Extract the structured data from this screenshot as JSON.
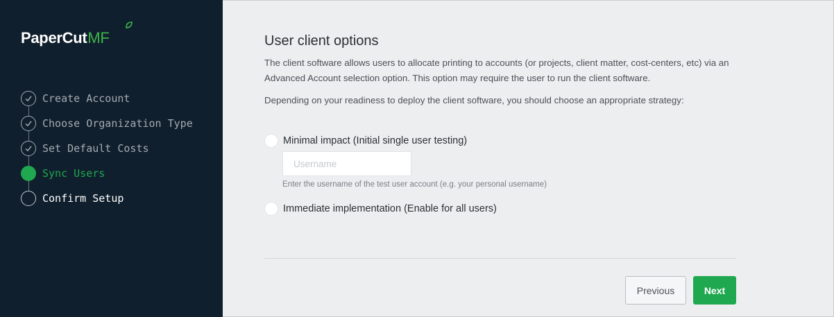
{
  "brand": {
    "name_main": "PaperCut",
    "name_suffix": "MF",
    "accent_color": "#1fa84f"
  },
  "steps": [
    {
      "label": "Create Account",
      "state": "done"
    },
    {
      "label": "Choose Organization Type",
      "state": "done"
    },
    {
      "label": "Set Default Costs",
      "state": "done"
    },
    {
      "label": "Sync Users",
      "state": "active"
    },
    {
      "label": "Confirm Setup",
      "state": "pending"
    }
  ],
  "main": {
    "title": "User client options",
    "description": "The client software allows users to allocate printing to accounts (or projects, client matter, cost-centers, etc) via an Advanced Account selection option. This option may require the user to run the client software.",
    "strategy_prompt": "Depending on your readiness to deploy the client software, you should choose an appropriate strategy:",
    "options": [
      {
        "label": "Minimal impact (Initial single user testing)",
        "selected": false
      },
      {
        "label": "Immediate implementation (Enable for all users)",
        "selected": false
      }
    ],
    "username": {
      "placeholder": "Username",
      "value": "",
      "hint": "Enter the username of the test user account (e.g. your personal username)"
    }
  },
  "footer": {
    "previous_label": "Previous",
    "next_label": "Next"
  }
}
